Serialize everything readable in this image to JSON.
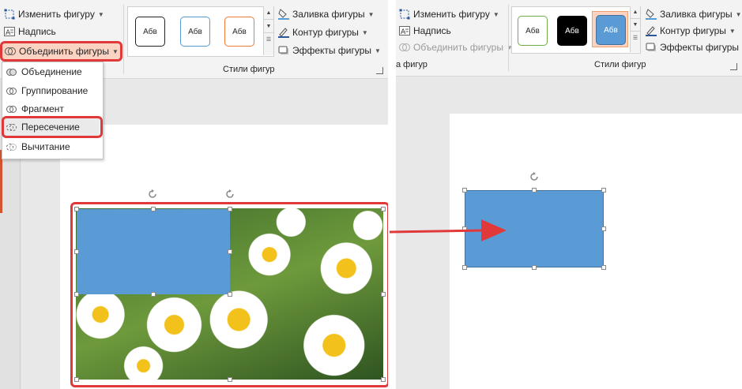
{
  "left_panel": {
    "ribbon": {
      "edit_shape": "Изменить фигуру",
      "text_box": "Надпись",
      "merge_shapes": "Объединить фигуры",
      "style_sample": "Абв",
      "shape_fill": "Заливка фигуры",
      "shape_outline": "Контур фигуры",
      "shape_effects": "Эффекты фигуры",
      "shape_styles_group": "Стили фигур"
    },
    "merge_menu": [
      {
        "label": "Объединение"
      },
      {
        "label": "Группирование"
      },
      {
        "label": "Фрагмент"
      },
      {
        "label": "Пересечение"
      },
      {
        "label": "Вычитание"
      }
    ]
  },
  "right_panel": {
    "ribbon": {
      "edit_shape": "Изменить фигуру",
      "text_box": "Надпись",
      "merge_shapes": "Объединить фигуры",
      "style_sample": "Абв",
      "shape_fill": "Заливка фигуры",
      "shape_outline": "Контур фигуры",
      "shape_effects": "Эффекты фигуры",
      "shape_styles_group": "Стили фигур",
      "cut_group_label": "а фигур"
    }
  },
  "colors": {
    "highlight_red": "#e1393a",
    "shape_blue": "#5b9bd5",
    "ribbon_bg": "#f3f3f3",
    "slide_area_bg": "#e8e8e8"
  }
}
